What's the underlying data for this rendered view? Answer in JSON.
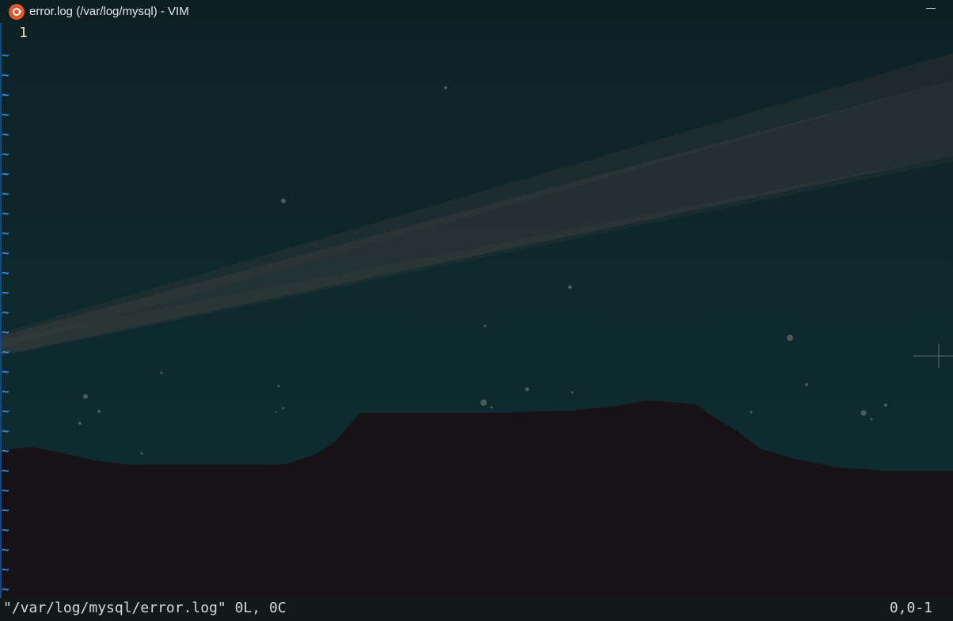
{
  "window": {
    "title": "error.log (/var/log/mysql) - VIM",
    "app_icon": "ubuntu-icon"
  },
  "editor": {
    "line_numbers": [
      "1"
    ],
    "empty_line_marker": "~",
    "empty_line_count": 28
  },
  "statusbar": {
    "message": "\"/var/log/mysql/error.log\" 0L, 0C",
    "position": "0,0-1"
  },
  "colors": {
    "background": "#0c2327",
    "tilde": "#2f8ee4",
    "line_number": "#e8e6a8",
    "ground": "#161215"
  }
}
